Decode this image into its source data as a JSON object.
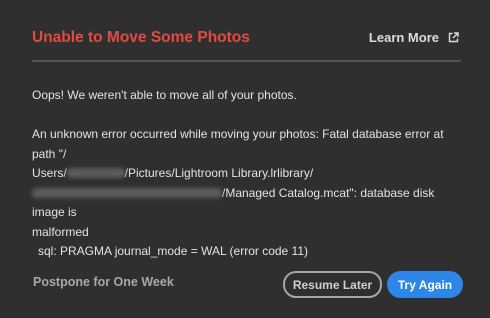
{
  "dialog": {
    "title": "Unable to Move Some Photos",
    "learn_more_label": "Learn More",
    "learn_more_icon": "external-link-icon",
    "title_color": "#e34a44",
    "accent_color": "#2d86e8"
  },
  "message": {
    "intro": "Oops! We weren't able to move all of your photos.",
    "error_part1": "An unknown error occurred while moving your photos: Fatal database error at path \"/",
    "error_users": "Users/",
    "error_path_mid": "/Pictures/Lightroom Library.lrlibrary/",
    "error_path_end": "/Managed Catalog.mcat\": database disk image is",
    "error_malformed": "malformed",
    "sql_line": "sql: PRAGMA journal_mode = WAL (error code 11)"
  },
  "actions": {
    "postpone_label": "Postpone for One Week",
    "resume_label": "Resume Later",
    "try_again_label": "Try Again"
  }
}
